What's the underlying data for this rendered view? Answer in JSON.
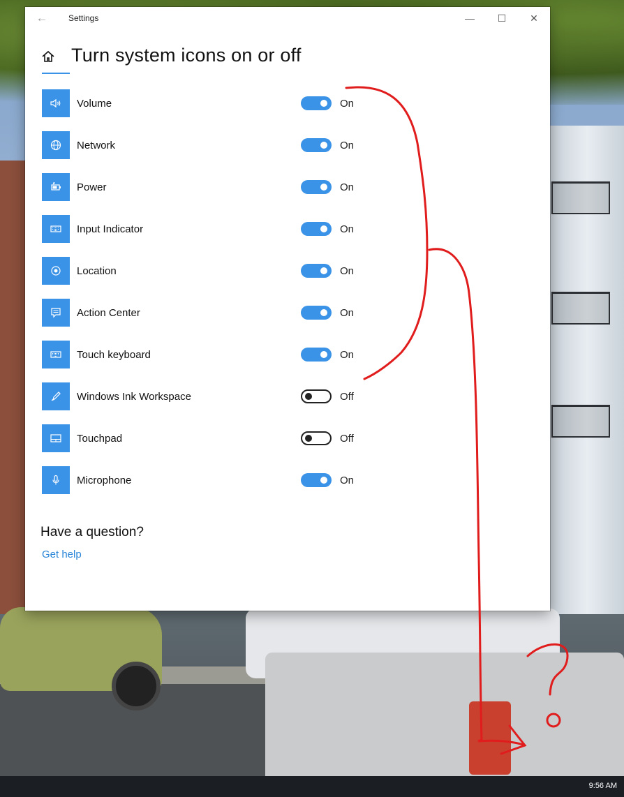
{
  "window": {
    "app_title": "Settings",
    "page_title": "Turn system icons on or off"
  },
  "items": [
    {
      "label": "Volume",
      "state": "On",
      "icon": "volume-icon"
    },
    {
      "label": "Network",
      "state": "On",
      "icon": "network-globe-icon"
    },
    {
      "label": "Power",
      "state": "On",
      "icon": "battery-icon"
    },
    {
      "label": "Input Indicator",
      "state": "On",
      "icon": "keyboard-icon"
    },
    {
      "label": "Location",
      "state": "On",
      "icon": "location-icon"
    },
    {
      "label": "Action Center",
      "state": "On",
      "icon": "action-center-icon"
    },
    {
      "label": "Touch keyboard",
      "state": "On",
      "icon": "keyboard-icon"
    },
    {
      "label": "Windows Ink Workspace",
      "state": "Off",
      "icon": "pen-icon"
    },
    {
      "label": "Touchpad",
      "state": "Off",
      "icon": "touchpad-icon"
    },
    {
      "label": "Microphone",
      "state": "On",
      "icon": "microphone-icon"
    }
  ],
  "help": {
    "question": "Have a question?",
    "link": "Get help"
  },
  "taskbar": {
    "clock": "9:56 AM"
  },
  "colors": {
    "accent": "#3b93e8",
    "annotation": "#e01c1c"
  }
}
